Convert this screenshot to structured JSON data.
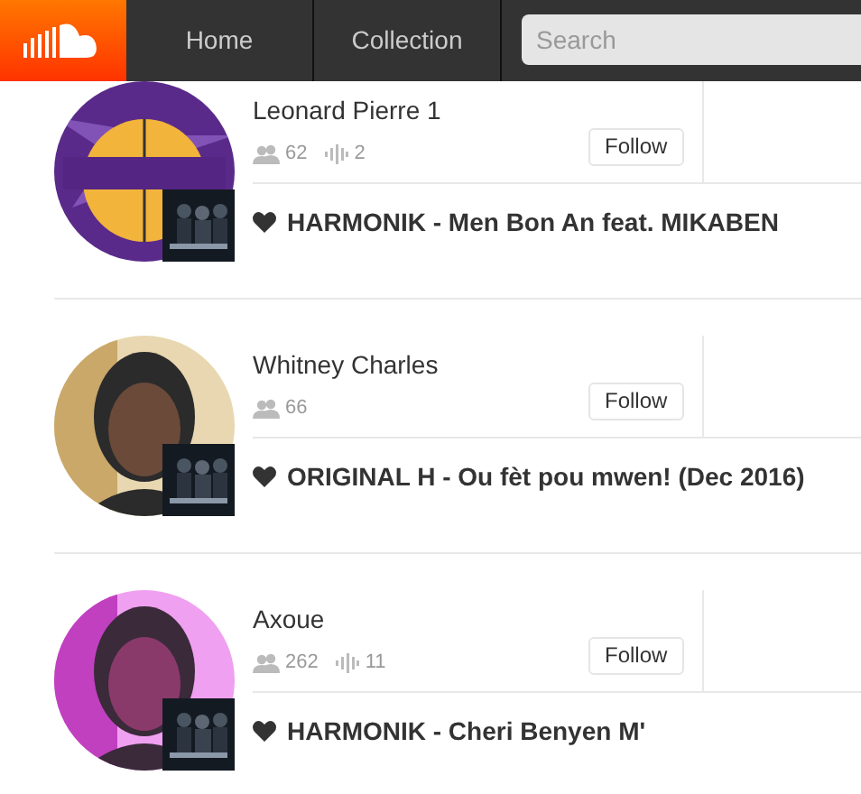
{
  "nav": {
    "items": [
      {
        "label": "Home",
        "selected": false
      },
      {
        "label": "Collection",
        "selected": false
      }
    ],
    "search": {
      "placeholder": "Search"
    }
  },
  "users": [
    {
      "name": "Leonard Pierre 1",
      "followers": "62",
      "tracks": "2",
      "follow_label": "Follow",
      "liked_track": "HARMONIK - Men Bon An feat. MIKABEN"
    },
    {
      "name": "Whitney Charles",
      "followers": "66",
      "follow_label": "Follow",
      "liked_track": "ORIGINAL H - Ou fèt pou mwen! (Dec 2016)"
    },
    {
      "name": "Axoue",
      "followers": "262",
      "tracks": "11",
      "follow_label": "Follow",
      "liked_track": "HARMONIK - Cheri Benyen M'"
    }
  ]
}
